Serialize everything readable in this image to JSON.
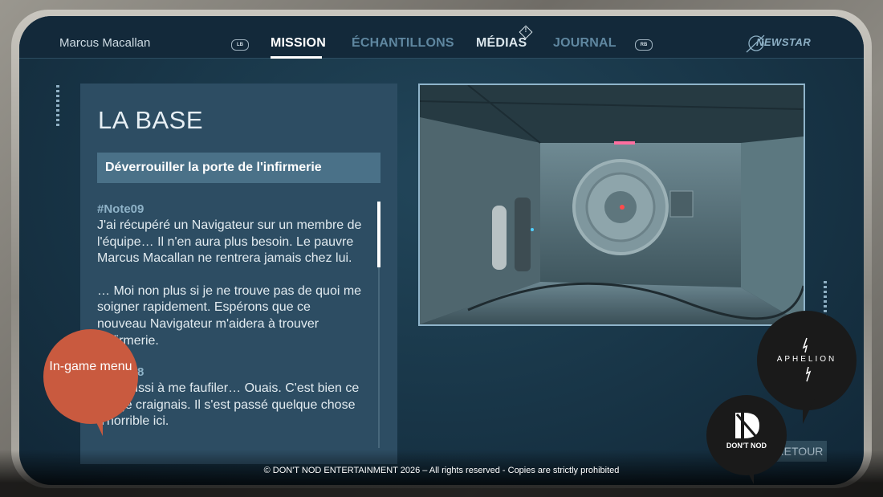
{
  "header": {
    "player_name": "Marcus Macallan",
    "left_bumper": "LB",
    "right_bumper": "RB",
    "tabs": [
      {
        "label": "MISSION",
        "state": "active"
      },
      {
        "label": "ÉCHANTILLONS",
        "state": "inactive"
      },
      {
        "label": "MÉDIAS",
        "state": "notification"
      },
      {
        "label": "JOURNAL",
        "state": "inactive"
      }
    ],
    "notification_mark": "!",
    "brand": "NEWSTAR"
  },
  "mission": {
    "title": "LA BASE",
    "objective": "Déverrouiller la porte de l'infirmerie",
    "notes": [
      {
        "tag": "#Note09",
        "paragraphs": [
          "J'ai récupéré un Navigateur sur un membre de l'équipe… Il n'en aura plus besoin. Le pauvre Marcus Macallan ne rentrera jamais chez lui.",
          "… Moi non plus si je ne trouve pas de quoi me soigner rapidement. Espérons que ce nouveau Navigateur m'aidera à trouver l'infirmerie."
        ]
      },
      {
        "tag": "#Note08",
        "paragraphs": [
          "J'ai réussi à me faufiler… Ouais. C'est bien ce que je craignais. Il s'est passé quelque chose d'horrible ici."
        ]
      }
    ]
  },
  "actions": {
    "back": "RETOUR"
  },
  "overlay": {
    "callout": "In-game menu",
    "game_logo": "APHELION",
    "studio_logo": "DON'T NOD",
    "footer": "© DON'T NOD ENTERTAINMENT 2026 – All rights reserved - Copies are strictly prohibited"
  },
  "colors": {
    "accent_callout": "#c95a3f",
    "panel": "#2d4d63",
    "objective_bar": "#4a7188",
    "note_tag": "#8fb3c8"
  },
  "icons": [
    "newstar-logo-icon",
    "aphelion-logo-icon",
    "dontnod-logo-icon",
    "notification-icon"
  ]
}
